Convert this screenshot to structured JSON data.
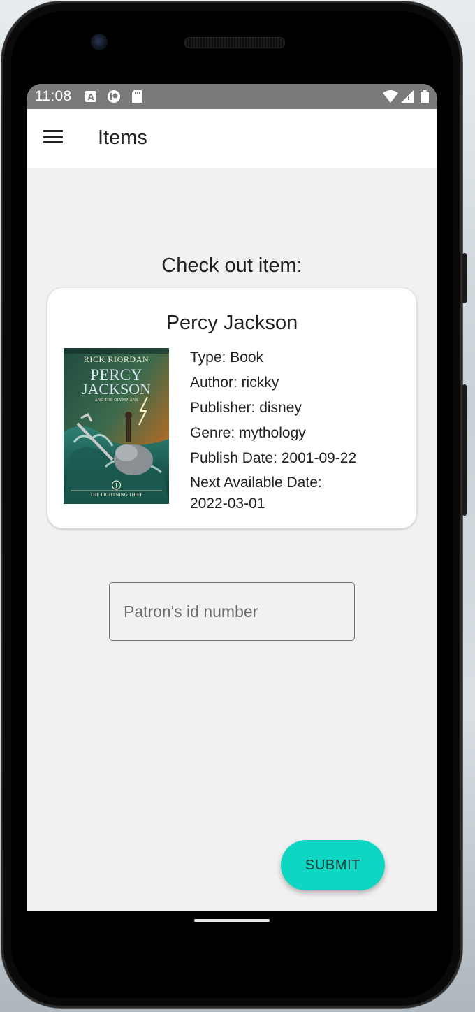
{
  "status_bar": {
    "time": "11:08",
    "left_icons": [
      "font-icon",
      "app-notification-icon",
      "sd-card-icon"
    ],
    "right_icons": [
      "wifi-icon",
      "cell-signal-icon",
      "battery-icon"
    ]
  },
  "app_bar": {
    "title": "Items",
    "menu_icon": "hamburger-menu-icon"
  },
  "main": {
    "section_title": "Check out item:"
  },
  "item_card": {
    "title": "Percy Jackson",
    "cover": {
      "author_line": "RICK RIORDAN",
      "title_line1": "PERCY",
      "title_line2": "JACKSON",
      "subtitle": "AND THE OLYMPIANS",
      "book_number": "1",
      "book_title": "THE LIGHTNING THIEF"
    },
    "type": "Type: Book",
    "author": "Author: rickky",
    "publisher": "Publisher: disney",
    "genre": "Genre: mythology",
    "publish_date": "Publish Date: 2001-09-22",
    "next_available": "Next Available Date: 2022-03-01"
  },
  "form": {
    "patron_placeholder": "Patron's id number",
    "patron_value": ""
  },
  "submit": {
    "label": "SUBMIT",
    "color": "#0fd6c2"
  },
  "colors": {
    "status_bar": "#7a7a7a",
    "app_bar": "#ffffff",
    "background": "#f1f1f1",
    "accent": "#0fd6c2"
  }
}
